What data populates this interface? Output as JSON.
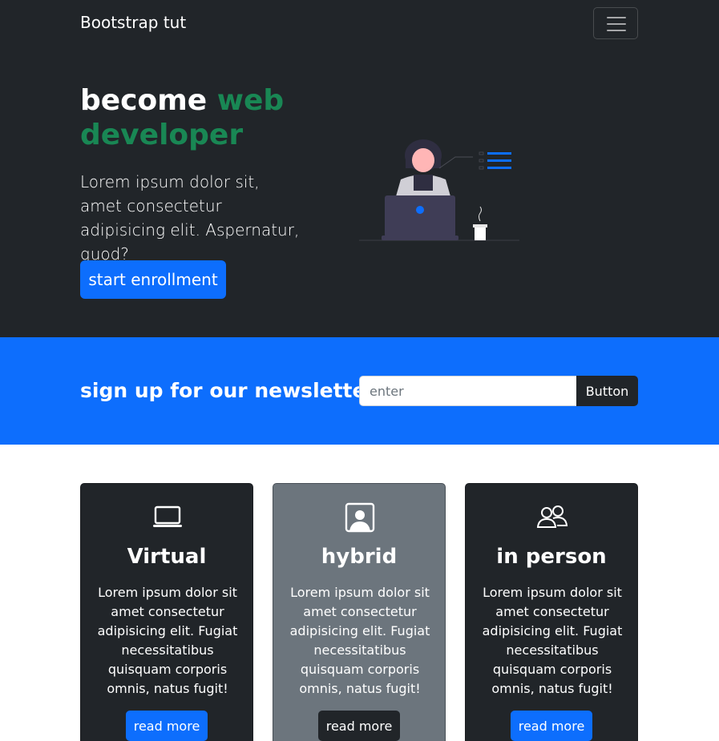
{
  "navbar": {
    "brand": "Bootstrap tut"
  },
  "hero": {
    "title_part1": "become ",
    "title_accent": "web developer",
    "text": "Lorem ipsum dolor sit, amet consectetur adipisicing elit. Aspernatur, quod?",
    "button_label": "start enrollment"
  },
  "newsletter": {
    "title": "sign up for our newsletter",
    "placeholder": "enter",
    "button_label": "Button"
  },
  "cards": [
    {
      "title": "Virtual",
      "text": "Lorem ipsum dolor sit amet consectetur adipisicing elit. Fugiat necessitatibus quisquam corporis omnis, natus fugit!",
      "button_label": "read more",
      "icon": "laptop-icon"
    },
    {
      "title": "hybrid",
      "text": "Lorem ipsum dolor sit amet consectetur adipisicing elit. Fugiat necessitatibus quisquam corporis omnis, natus fugit!",
      "button_label": "read more",
      "icon": "person-badge-icon"
    },
    {
      "title": "in person",
      "text": "Lorem ipsum dolor sit amet consectetur adipisicing elit. Fugiat necessitatibus quisquam corporis omnis, natus fugit!",
      "button_label": "read more",
      "icon": "people-icon"
    }
  ],
  "colors": {
    "dark": "#212529",
    "primary": "#0d6efd",
    "success": "#198754",
    "secondary": "#6c757d"
  }
}
